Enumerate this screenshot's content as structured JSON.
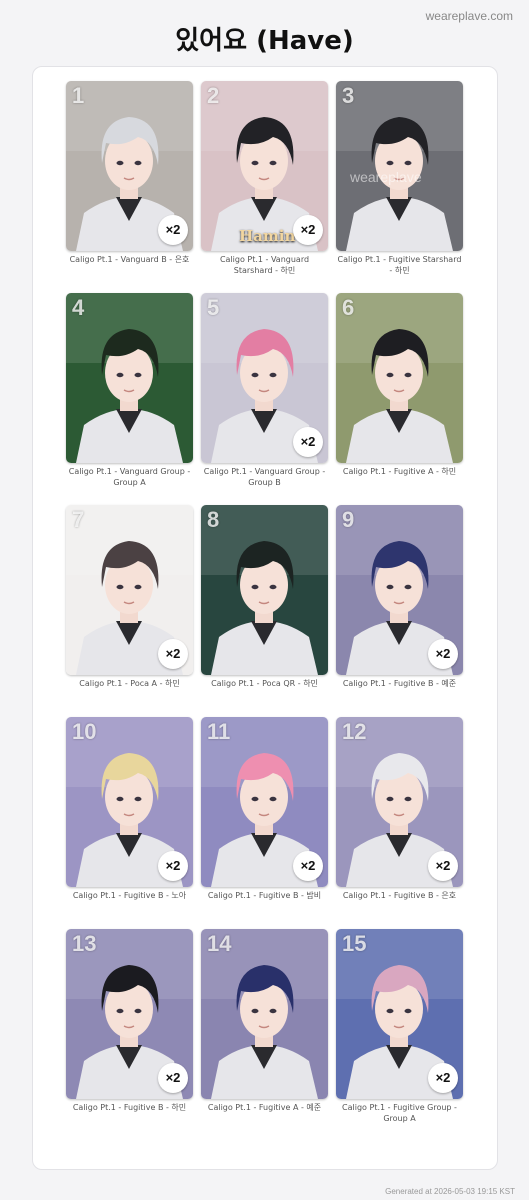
{
  "header": {
    "title": "있어요 (Have)",
    "site": "weareplave.com"
  },
  "footer": {
    "generated": "Generated at 2026-05-03 19:15 KST"
  },
  "cards": [
    {
      "number": "1",
      "caption": "Caligo Pt.1 - Vanguard B - 은호",
      "quantity": "×2",
      "hair": "#d7d9de",
      "bg": "#b7b2ad"
    },
    {
      "number": "2",
      "caption": "Caligo Pt.1 - Vanguard Starshard - 하민",
      "quantity": "×2",
      "hair": "#222226",
      "bg": "#d9c2c6",
      "overlay_text": "Hamin"
    },
    {
      "number": "3",
      "caption": "Caligo Pt.1 - Fugitive Starshard - 하민",
      "quantity": "",
      "hair": "#222226",
      "bg": "#6d6e74",
      "watermark": "weareplave"
    },
    {
      "number": "4",
      "caption": "Caligo Pt.1 - Vanguard Group - Group A",
      "quantity": "",
      "hair": "#1d2a1e",
      "bg": "#2c5a34"
    },
    {
      "number": "5",
      "caption": "Caligo Pt.1 - Vanguard Group - Group B",
      "quantity": "×2",
      "hair": "#e37ea3",
      "bg": "#c9c6d4"
    },
    {
      "number": "6",
      "caption": "Caligo Pt.1 - Fugitive A - 하민",
      "quantity": "",
      "hair": "#1e1e22",
      "bg": "#8f9a6e"
    },
    {
      "number": "7",
      "caption": "Caligo Pt.1 - Poca A - 하민",
      "quantity": "×2",
      "hair": "#4b4143",
      "bg": "#f1efee"
    },
    {
      "number": "8",
      "caption": "Caligo Pt.1 - Poca QR - 하민",
      "quantity": "",
      "hair": "#1c2422",
      "bg": "#28463f"
    },
    {
      "number": "9",
      "caption": "Caligo Pt.1 - Fugitive B - 예준",
      "quantity": "×2",
      "hair": "#2e356e",
      "bg": "#8b87ad"
    },
    {
      "number": "10",
      "caption": "Caligo Pt.1 - Fugitive B - 노아",
      "quantity": "×2",
      "hair": "#e8d69c",
      "bg": "#9c95c4"
    },
    {
      "number": "11",
      "caption": "Caligo Pt.1 - Fugitive B - 밤비",
      "quantity": "×2",
      "hair": "#ee8fb0",
      "bg": "#8f8bc0"
    },
    {
      "number": "12",
      "caption": "Caligo Pt.1 - Fugitive B - 은호",
      "quantity": "×2",
      "hair": "#e8e8ec",
      "bg": "#9b96bd"
    },
    {
      "number": "13",
      "caption": "Caligo Pt.1 - Fugitive B - 하민",
      "quantity": "×2",
      "hair": "#1b1b20",
      "bg": "#8e89b4"
    },
    {
      "number": "14",
      "caption": "Caligo Pt.1 - Fugitive A - 예준",
      "quantity": "",
      "hair": "#29306a",
      "bg": "#8a85b0"
    },
    {
      "number": "15",
      "caption": "Caligo Pt.1 - Fugitive Group - Group A",
      "quantity": "×2",
      "hair": "#d9a7c0",
      "bg": "#5e6fb0"
    }
  ]
}
